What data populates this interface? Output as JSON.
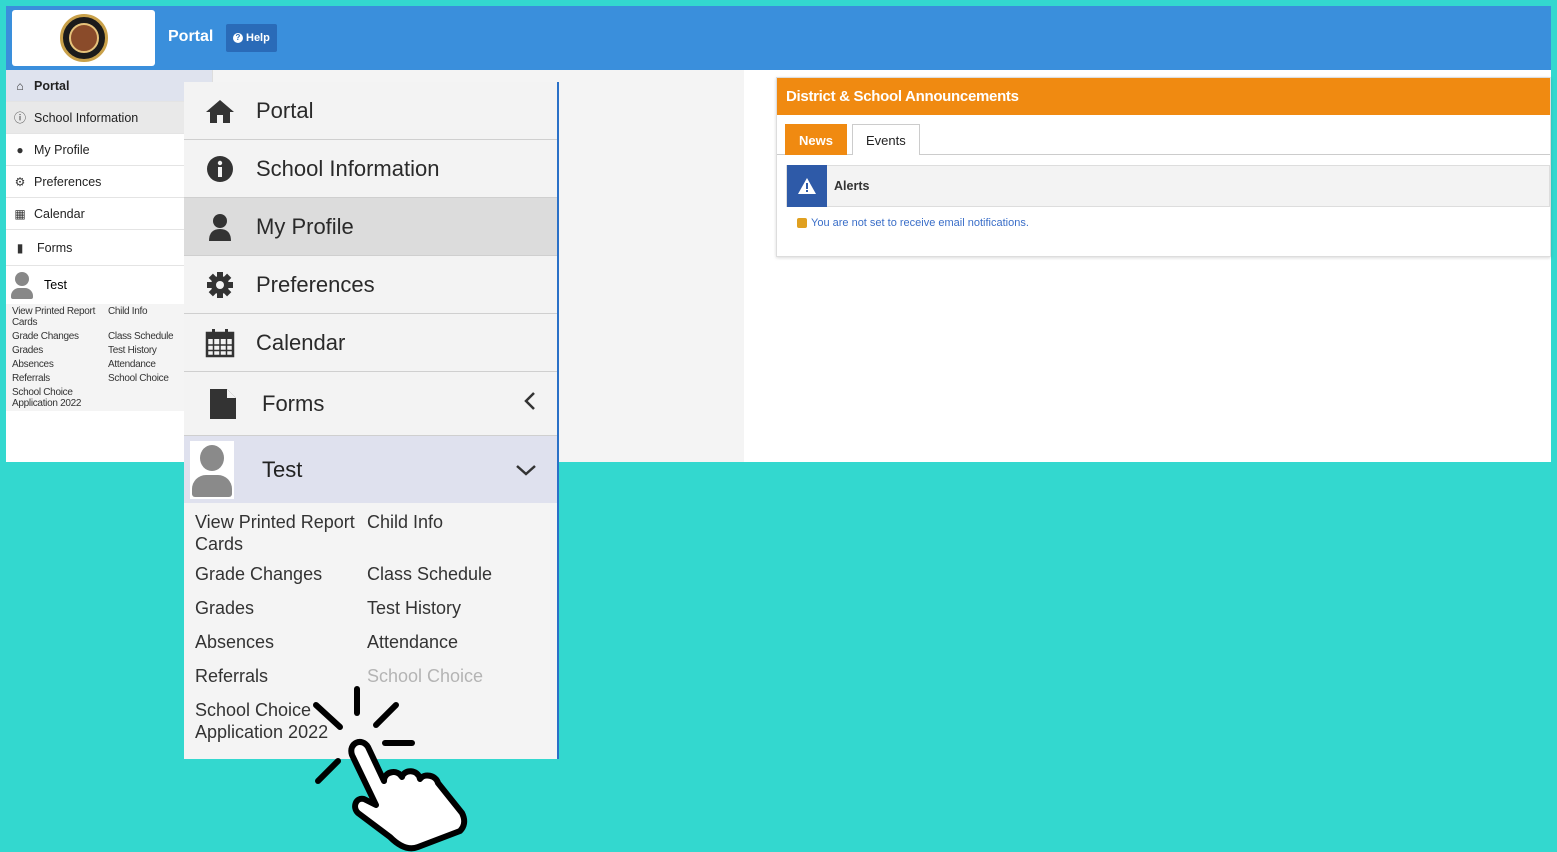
{
  "header": {
    "title": "Portal",
    "help_label": "Help"
  },
  "sidebar_small": {
    "items": [
      {
        "label": "Portal",
        "icon": "home-icon"
      },
      {
        "label": "School Information",
        "icon": "info-icon"
      },
      {
        "label": "My Profile",
        "icon": "user-icon"
      },
      {
        "label": "Preferences",
        "icon": "gear-icon"
      },
      {
        "label": "Calendar",
        "icon": "calendar-icon"
      },
      {
        "label": "Forms",
        "icon": "document-icon"
      }
    ],
    "student": "Test",
    "links": [
      "View Printed Report Cards",
      "Child Info",
      "Grade Changes",
      "Class Schedule",
      "Grades",
      "Test History",
      "Absences",
      "Attendance",
      "Referrals",
      "School Choice",
      "School Choice Application 2022"
    ]
  },
  "announcements": {
    "title": "District & School Announcements",
    "tabs": [
      "News",
      "Events"
    ],
    "alerts_label": "Alerts",
    "notice": "You are not set to receive email notifications."
  },
  "zoom_menu": {
    "items": [
      {
        "label": "Portal",
        "icon": "home-icon"
      },
      {
        "label": "School Information",
        "icon": "info-icon"
      },
      {
        "label": "My Profile",
        "icon": "user-icon"
      },
      {
        "label": "Preferences",
        "icon": "gear-icon"
      },
      {
        "label": "Calendar",
        "icon": "calendar-icon"
      }
    ],
    "forms_label": "Forms",
    "student": "Test",
    "links": {
      "view_printed": "View Printed Report Cards",
      "child_info": "Child Info",
      "grade_changes": "Grade Changes",
      "class_schedule": "Class Schedule",
      "grades": "Grades",
      "test_history": "Test History",
      "absences": "Absences",
      "attendance": "Attendance",
      "referrals": "Referrals",
      "school_choice": "School Choice",
      "school_choice_app": "School Choice Application 2022"
    }
  },
  "colors": {
    "background": "#33d8cf",
    "header": "#3a8fdc",
    "accent_orange": "#f08a11",
    "alert_blue": "#2e5aa8"
  }
}
